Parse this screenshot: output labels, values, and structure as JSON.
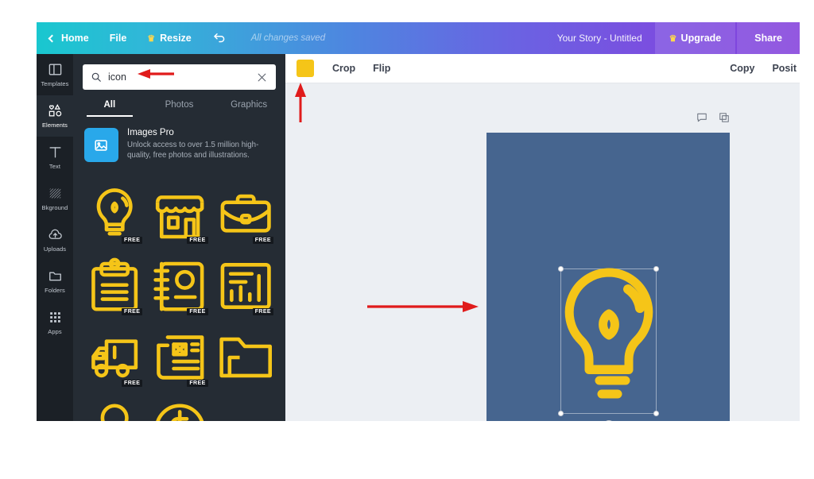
{
  "header": {
    "home_label": "Home",
    "file_label": "File",
    "resize_label": "Resize",
    "crown_glyph": "♛",
    "undo_name": "undo-icon",
    "saved_status": "All changes saved",
    "doc_title": "Your Story - Untitled",
    "upgrade_label": "Upgrade",
    "share_label": "Share"
  },
  "rail": {
    "items": [
      {
        "label": "Templates",
        "icon": "templates-icon",
        "active": false
      },
      {
        "label": "Elements",
        "icon": "elements-icon",
        "active": true
      },
      {
        "label": "Text",
        "icon": "text-icon",
        "active": false
      },
      {
        "label": "Bkground",
        "icon": "background-icon",
        "active": false
      },
      {
        "label": "Uploads",
        "icon": "uploads-icon",
        "active": false
      },
      {
        "label": "Folders",
        "icon": "folders-icon",
        "active": false
      },
      {
        "label": "Apps",
        "icon": "apps-icon",
        "active": false
      }
    ]
  },
  "panel": {
    "search": {
      "value": "icon",
      "placeholder": "Search",
      "search_icon": "search-icon",
      "clear_icon": "close-icon"
    },
    "tabs": [
      {
        "label": "All",
        "active": true
      },
      {
        "label": "Photos",
        "active": false
      },
      {
        "label": "Graphics",
        "active": false
      }
    ],
    "promo": {
      "icon": "image-icon",
      "title": "Images Pro",
      "subtitle": "Unlock access to over 1.5 million high-quality, free photos and illustrations."
    },
    "free_badge": "FREE",
    "results": [
      {
        "name": "lightbulb-icon",
        "free": true
      },
      {
        "name": "storefront-icon",
        "free": true
      },
      {
        "name": "briefcase-icon",
        "free": true
      },
      {
        "name": "clipboard-icon",
        "free": true
      },
      {
        "name": "notebook-icon",
        "free": true
      },
      {
        "name": "barchart-icon",
        "free": true
      },
      {
        "name": "truck-icon",
        "free": true
      },
      {
        "name": "newspaper-icon",
        "free": true
      },
      {
        "name": "folder-icon",
        "free": false
      },
      {
        "name": "person-icon",
        "free": false
      },
      {
        "name": "dollar-coin-icon",
        "free": false
      }
    ],
    "collapse_icon": "chevron-left-icon"
  },
  "toolbar": {
    "color_swatch": "#f5c518",
    "crop_label": "Crop",
    "flip_label": "Flip",
    "copy_label": "Copy",
    "position_label": "Posit"
  },
  "canvas": {
    "comment_icon": "comment-icon",
    "duplicate_icon": "duplicate-icon",
    "artboard_color": "#46658f",
    "selected_element": "lightbulb-graphic",
    "element_color": "#f5c518",
    "rotate_icon": "rotate-icon"
  },
  "annotations": {
    "color": "#e01b1b",
    "arrows": [
      {
        "name": "annotation-arrow-search",
        "direction": "left"
      },
      {
        "name": "annotation-arrow-toolbar",
        "direction": "up"
      },
      {
        "name": "annotation-arrow-canvas",
        "direction": "right"
      }
    ]
  }
}
